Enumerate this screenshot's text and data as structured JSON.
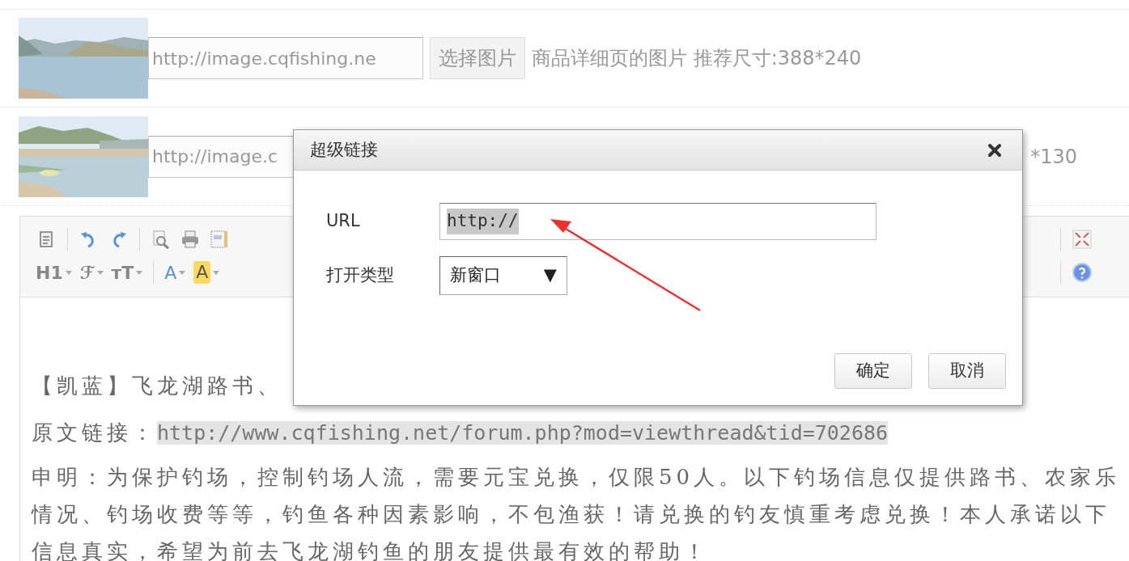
{
  "image_rows": [
    {
      "url_value": "http://image.cqfishing.ne",
      "button": "选择图片",
      "hint": "商品详细页的图片 推荐尺寸:388*240"
    },
    {
      "url_value": "http://image.c",
      "hint": "*130"
    }
  ],
  "editor": {
    "toolbar_row_2": [
      {
        "kind": "dropdown",
        "label": "H1"
      },
      {
        "kind": "dropdown",
        "label": "ℱ"
      },
      {
        "kind": "dropdown",
        "label": "ᴛT"
      },
      {
        "kind": "divider"
      },
      {
        "kind": "color",
        "label": "A"
      },
      {
        "kind": "highlight",
        "label": "A"
      }
    ],
    "content": {
      "intro": "【凯蓝】飞龙湖路书、",
      "link_label": "原文链接：",
      "link_url": "http://www.cqfishing.net/forum.php?mod=viewthread&tid=702686",
      "statement": "申明：为保护钓场，控制钓场人流，需要元宝兑换，仅限50人。以下钓场信息仅提供路书、农家乐情况、钓场收费等等，钓鱼各种因素影响，不包渔获！请兑换的钓友慎重考虑兑换！本人承诺以下信息真实，希望为前去飞龙湖钓鱼的朋友提供最有效的帮助！"
    }
  },
  "dialog": {
    "title": "超级链接",
    "url_label": "URL",
    "url_value": "http://",
    "url_value_selected": true,
    "target_label": "打开类型",
    "target_value": "新窗口",
    "target_arrow": "▼",
    "buttons": [
      "确定",
      "取消"
    ]
  }
}
